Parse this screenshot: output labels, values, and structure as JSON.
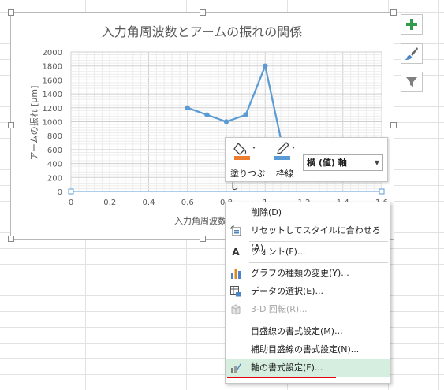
{
  "chart_data": {
    "type": "line",
    "title": "入力角周波数とアームの振れの関係",
    "xlabel": "入力角周波数",
    "ylabel": "アームの振れ [µm]",
    "x": [
      0.6,
      0.7,
      0.8,
      0.9,
      1.0,
      1.1
    ],
    "values": [
      1200,
      1100,
      1000,
      1100,
      1800,
      500
    ],
    "xlim": [
      0,
      1.6
    ],
    "ylim": [
      0,
      2000
    ],
    "x_ticks": [
      "0",
      "0.2",
      "0.4",
      "0.6",
      "0.8",
      "1",
      "1.2",
      "1.4",
      "1.6"
    ],
    "y_ticks": [
      "0",
      "200",
      "400",
      "600",
      "800",
      "1000",
      "1200",
      "1400",
      "1600",
      "1800",
      "2000"
    ],
    "grid": true,
    "color": "#5b9bd5"
  },
  "side_buttons": [
    {
      "icon": "plus-icon"
    },
    {
      "icon": "brush-icon"
    },
    {
      "icon": "filter-icon"
    }
  ],
  "mini_toolbar": {
    "fill_label": "塗りつぶし",
    "outline_label": "枠線",
    "element_select": "横 (値) 軸",
    "fill_color": "#ed7d31",
    "outline_color": "#5b9bd5"
  },
  "context_menu": {
    "items": [
      {
        "label": "削除(D)",
        "enabled": true
      },
      {
        "label": "リセットしてスタイルに合わせる(A)",
        "enabled": true
      },
      {
        "label": "フォント(F)...",
        "enabled": true
      },
      {
        "label": "グラフの種類の変更(Y)...",
        "enabled": true
      },
      {
        "label": "データの選択(E)...",
        "enabled": true
      },
      {
        "label": "3-D 回転(R)...",
        "enabled": false
      },
      {
        "label": "目盛線の書式設定(M)...",
        "enabled": true
      },
      {
        "label": "補助目盛線の書式設定(N)...",
        "enabled": true
      },
      {
        "label": "軸の書式設定(F)...",
        "enabled": true,
        "highlighted": true
      }
    ]
  }
}
